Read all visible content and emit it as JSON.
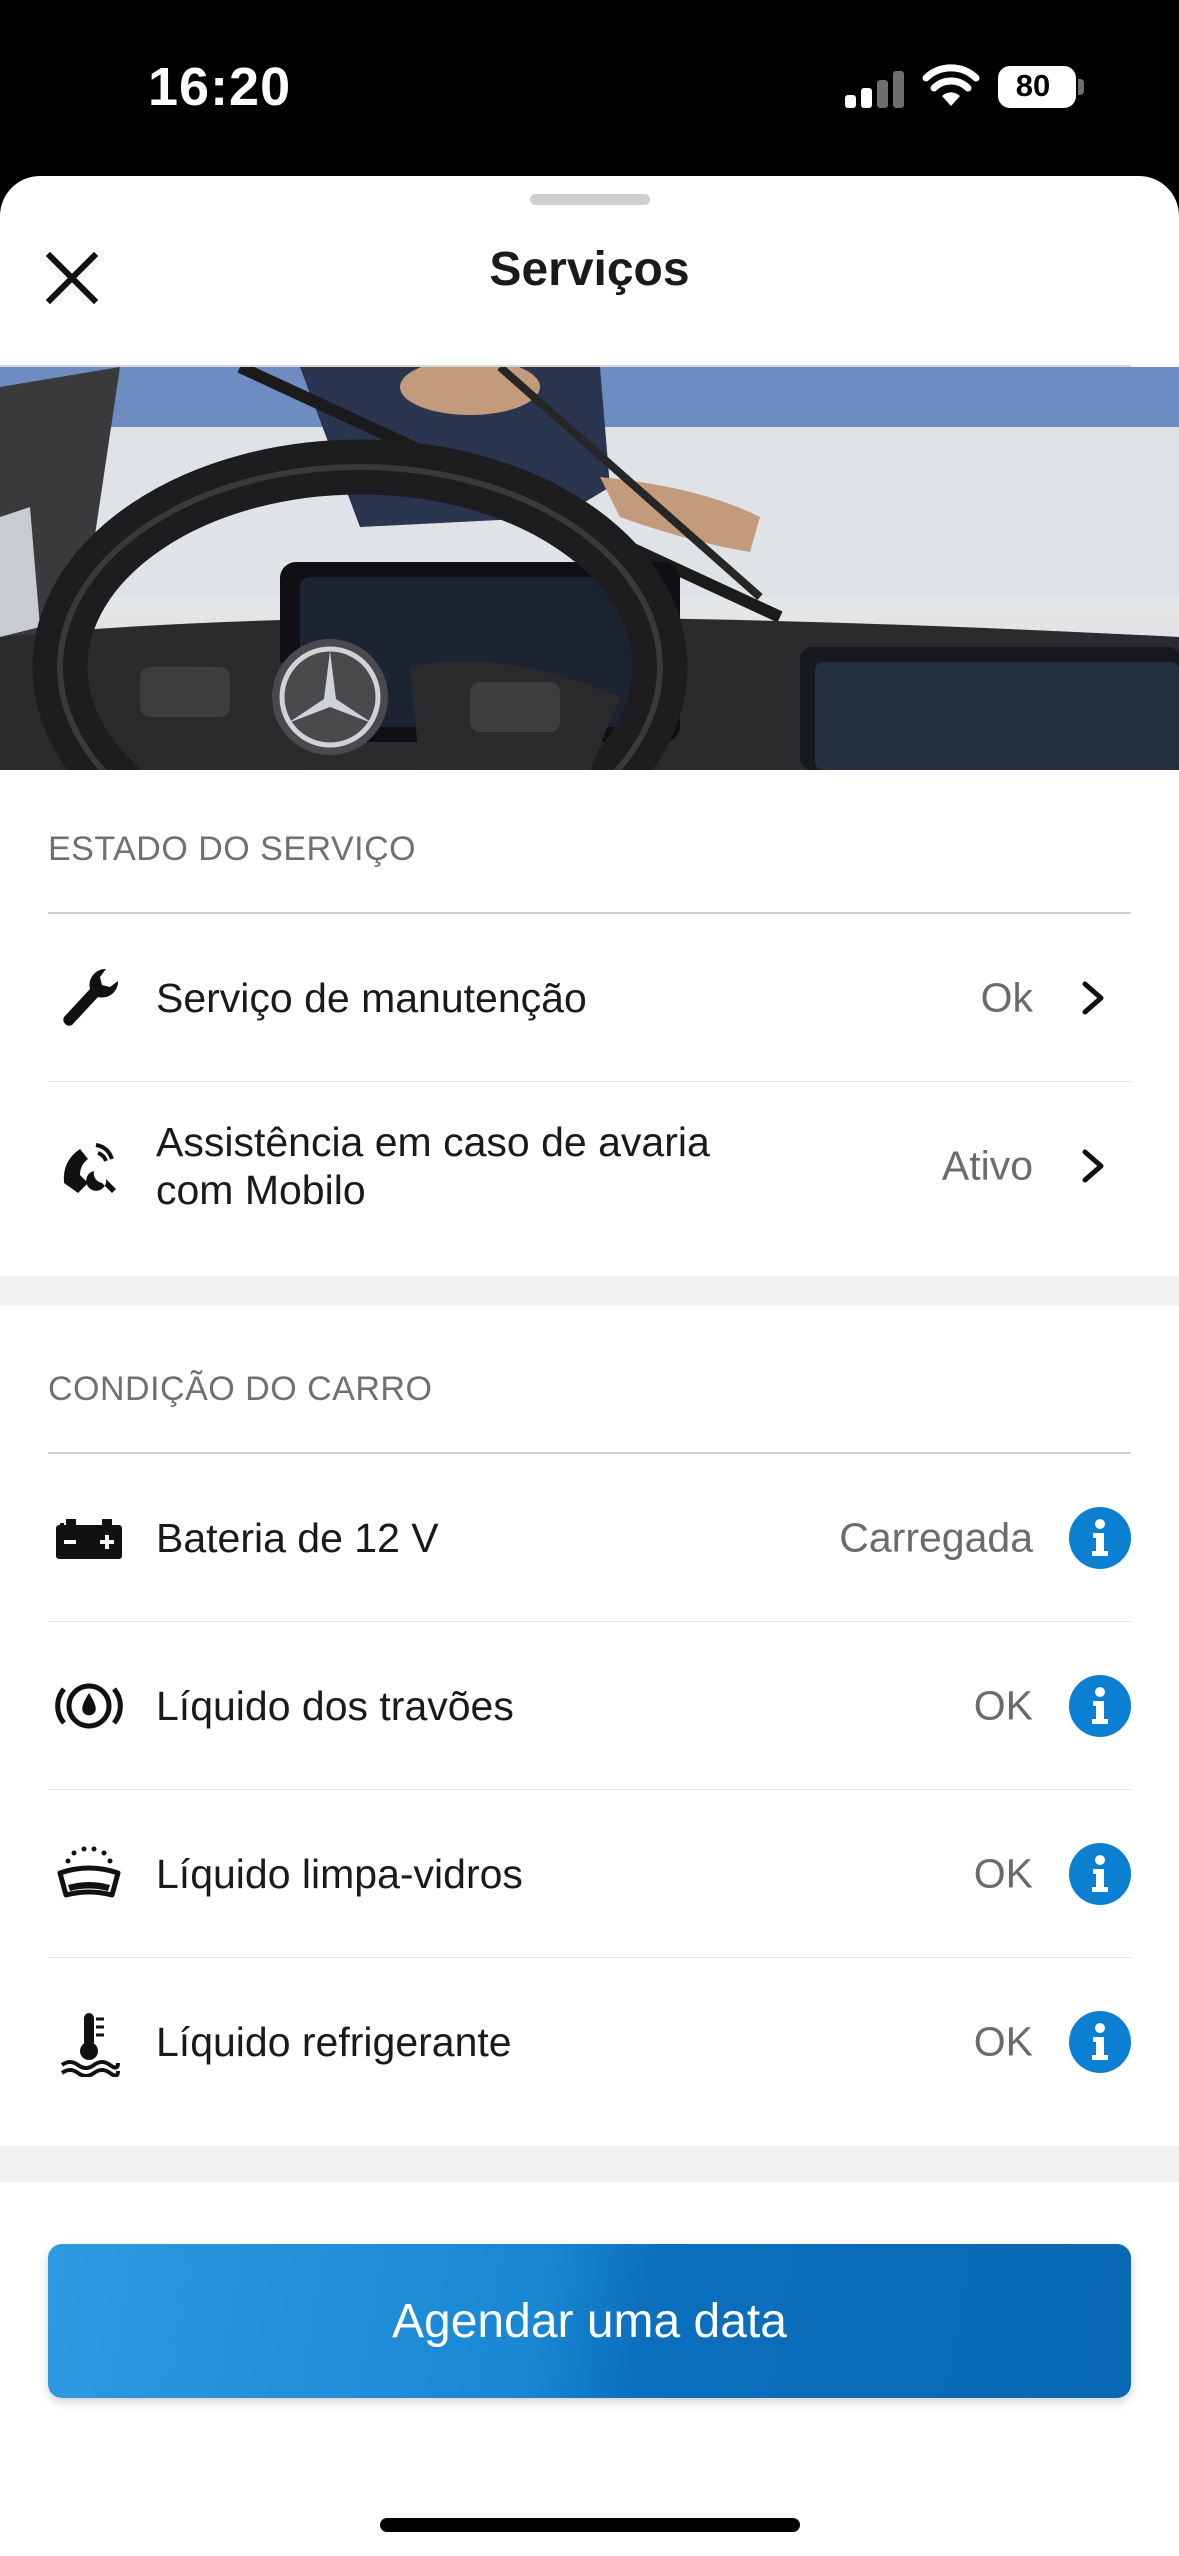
{
  "status_bar": {
    "time": "16:20",
    "battery": "80"
  },
  "sheet": {
    "title": "Serviços"
  },
  "service_status": {
    "heading": "ESTADO DO SERVIÇO",
    "items": [
      {
        "label": "Serviço de manutenção",
        "value": "Ok",
        "icon": "wrench-icon"
      },
      {
        "label": "Assistência em caso de avaria com Mobilo",
        "value": "Ativo",
        "icon": "roadside-phone-icon"
      }
    ]
  },
  "car_condition": {
    "heading": "CONDIÇÃO DO CARRO",
    "items": [
      {
        "label": "Bateria de 12 V",
        "value": "Carregada",
        "icon": "battery-icon"
      },
      {
        "label": "Líquido dos travões",
        "value": "OK",
        "icon": "brake-fluid-icon"
      },
      {
        "label": "Líquido limpa-vidros",
        "value": "OK",
        "icon": "washer-fluid-icon"
      },
      {
        "label": "Líquido refrigerante",
        "value": "OK",
        "icon": "coolant-icon"
      }
    ]
  },
  "footer": {
    "cta_label": "Agendar uma data"
  },
  "colors": {
    "accent": "#0b7fd1",
    "cta": "#1a87d3",
    "label_gray": "#707070"
  }
}
